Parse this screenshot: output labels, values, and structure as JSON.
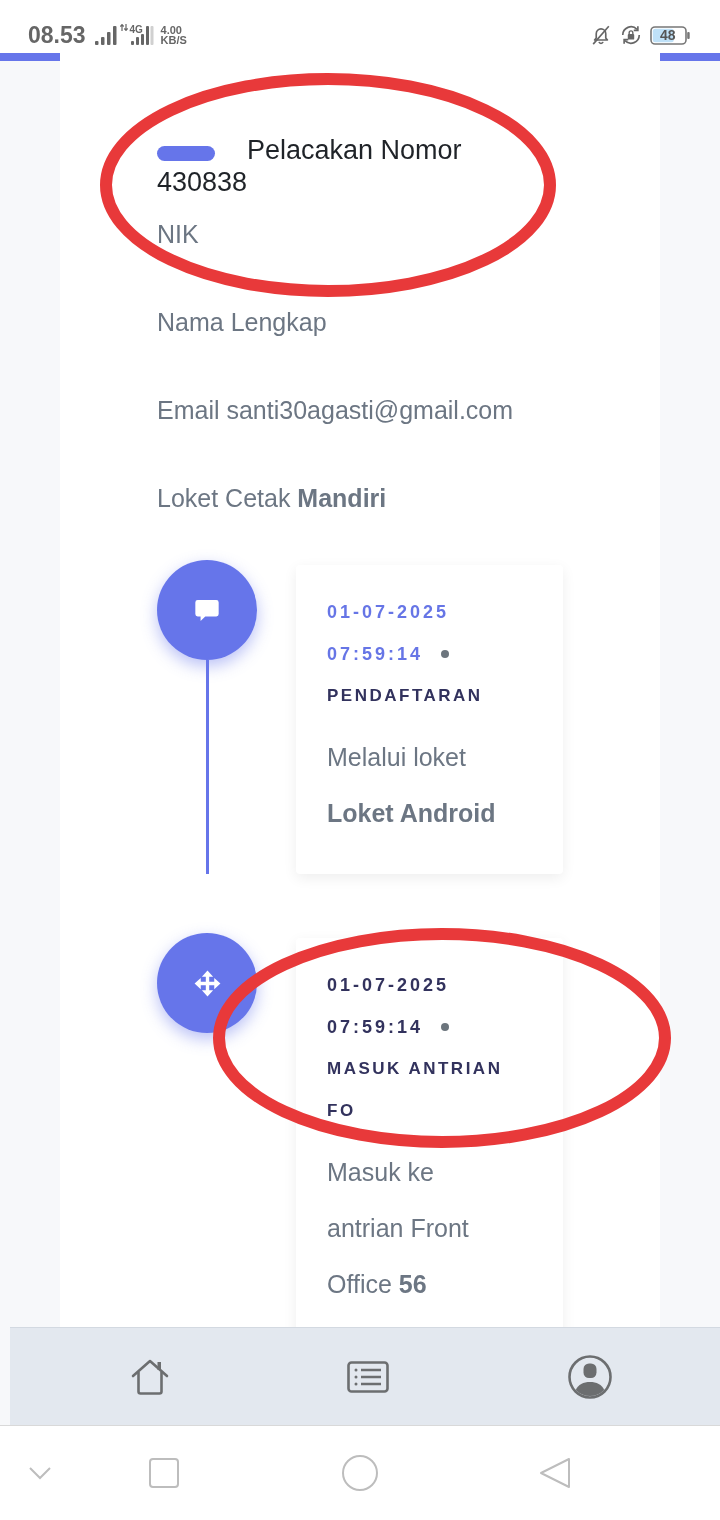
{
  "status_bar": {
    "time": "08.53",
    "network": "4G",
    "speed": "4.00",
    "speed_unit": "KB/S",
    "battery": "48"
  },
  "tracking": {
    "title": "Pelacakan Nomor",
    "number": "430838",
    "details": [
      "NIK",
      "Nama Lengkap",
      "Email santi30agasti@gmail.com",
      "Loket Cetak **Mandiri**"
    ]
  },
  "timeline": [
    {
      "kind": "registration",
      "date": "01-07-2025",
      "time": "07:59:14",
      "active": true,
      "title": "PENDAFTARAN",
      "description": "Melalui loket **Loket Android**"
    },
    {
      "kind": "queue",
      "date": "01-07-2025",
      "time": "07:59:14",
      "active": false,
      "title": "MASUK ANTRIAN FO",
      "description": "Masuk ke antrian Front Office **56**"
    }
  ]
}
